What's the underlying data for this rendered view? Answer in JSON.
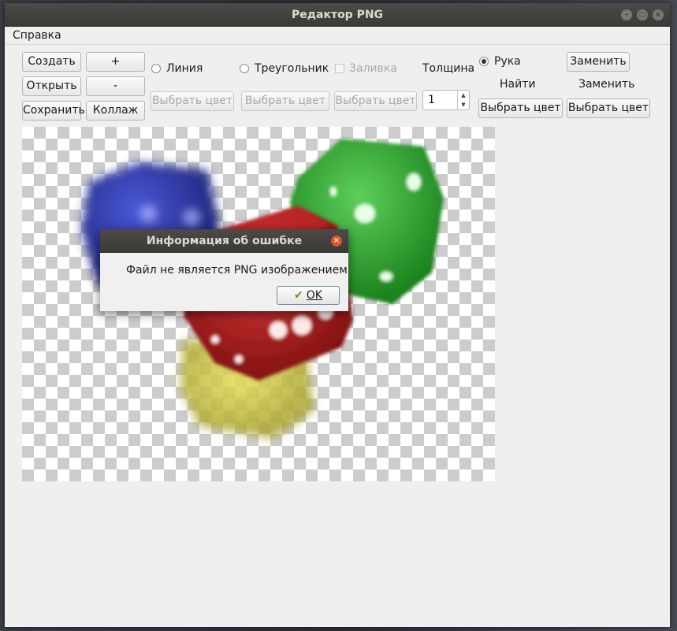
{
  "window": {
    "title": "Редактор PNG"
  },
  "menu": {
    "help": "Справка"
  },
  "toolbar": {
    "create": "Создать",
    "open": "Открыть",
    "save": "Сохранить",
    "zoom_in": "+",
    "zoom_out": "-",
    "collage": "Коллаж",
    "line": "Линия",
    "triangle": "Треугольник",
    "fill": "Заливка",
    "thickness": "Толщина",
    "thickness_value": "1",
    "hand": "Рука",
    "replace_button": "Заменить",
    "find_label": "Найти",
    "replace_label": "Заменить",
    "choose_color": "Выбрать цвет"
  },
  "dialog": {
    "title": "Информация об ошибке",
    "message": "Файл не является PNG изображением",
    "ok": "OK"
  }
}
